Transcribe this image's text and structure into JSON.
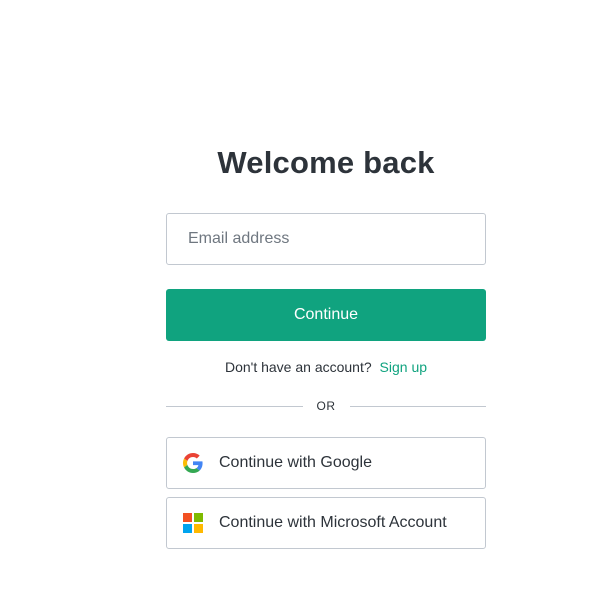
{
  "page": {
    "title": "Welcome back"
  },
  "email": {
    "placeholder": "Email address",
    "value": ""
  },
  "continue_button": {
    "label": "Continue"
  },
  "signup": {
    "prompt": "Don't have an account?",
    "link_label": "Sign up"
  },
  "divider": {
    "label": "OR"
  },
  "social": {
    "google": {
      "label": "Continue with Google",
      "icon": "google-icon"
    },
    "microsoft": {
      "label": "Continue with Microsoft Account",
      "icon": "microsoft-icon"
    }
  },
  "colors": {
    "accent": "#10a37f",
    "text": "#2d333a",
    "border": "#c2c8d0",
    "microsoft_red": "#f25022",
    "microsoft_green": "#7fba00",
    "microsoft_blue": "#00a4ef",
    "microsoft_yellow": "#ffb900"
  }
}
